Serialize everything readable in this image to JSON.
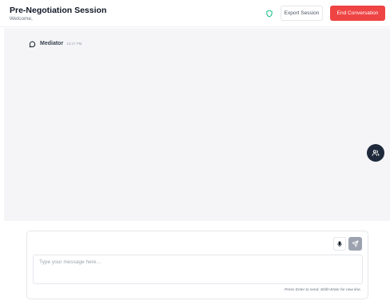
{
  "header": {
    "title": "Pre-Negotiation Session",
    "subtitle": "Welcome,",
    "export_label": "Export Session",
    "end_label": "End Conversation",
    "shield_icon": "shield-icon",
    "accent_color": "#10b981",
    "danger_color": "#ef4444"
  },
  "messages": [
    {
      "sender": "Mediator",
      "time": "10:27 PM",
      "icon": "chat-bubble-icon",
      "text": ""
    }
  ],
  "fab": {
    "icon": "users-icon",
    "color": "#1e293b"
  },
  "composer": {
    "placeholder": "Type your message here...",
    "value": "",
    "hint": "Press Enter to send, Shift+Enter for new line.",
    "mic_icon": "microphone-icon",
    "send_icon": "send-icon"
  }
}
